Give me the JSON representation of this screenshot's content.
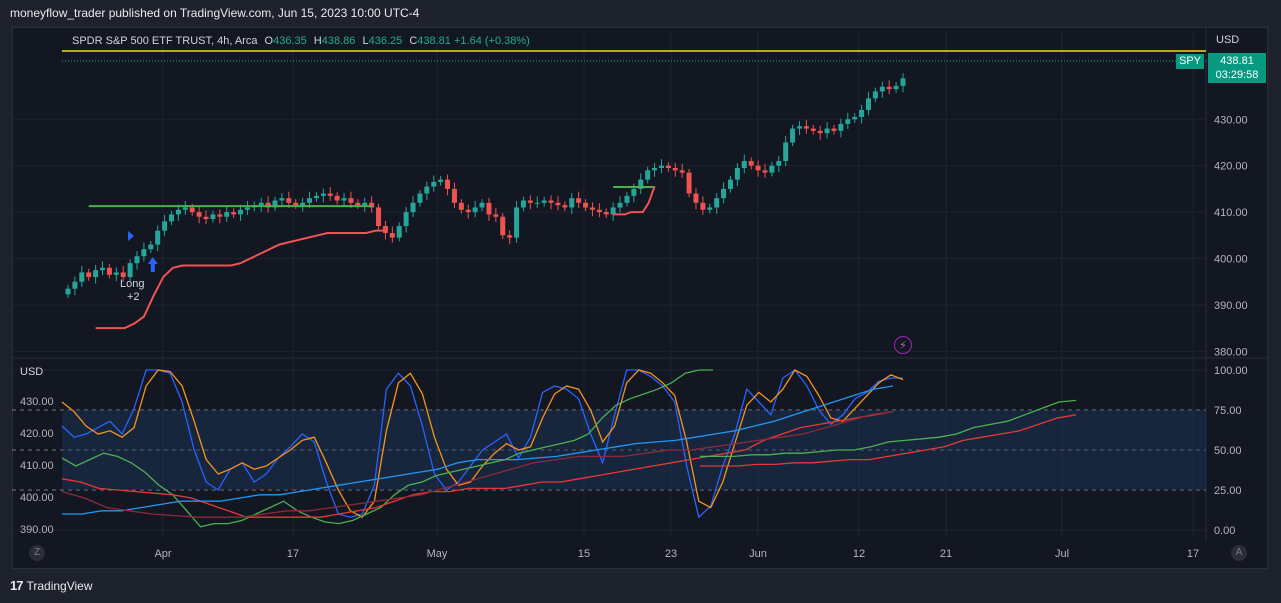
{
  "header": {
    "credit": "moneyflow_trader published on TradingView.com, Jun 15, 2023 10:00 UTC-4"
  },
  "symbol_line": {
    "title": "SPDR S&P 500 ETF TRUST, 4h, Arca",
    "o_label": "O",
    "o_value": "436.35",
    "h_label": "H",
    "h_value": "438.86",
    "l_label": "L",
    "l_value": "436.25",
    "c_label": "C",
    "c_value": "438.81",
    "change": "+1.64 (+0.38%)"
  },
  "price_panel": {
    "currency": "USD",
    "symbol_tag": "SPY",
    "last_price": "438.81",
    "countdown": "03:29:58",
    "signal_text": "Long",
    "signal_value": "+2"
  },
  "osc_panel": {
    "currency": "USD"
  },
  "footer": {
    "brand": "TradingView",
    "zoom_left": "Z",
    "zoom_right": "A"
  },
  "colors": {
    "up": "#26a69a",
    "down": "#ef5350",
    "resistance": "#4caf50",
    "trail_stop": "#f05454",
    "last_price_line": "#f0d723",
    "blue_osc": "#2962ff",
    "orange_osc": "#f7931a",
    "green_osc": "#4caf50",
    "red_osc": "#e53935",
    "cyan_osc": "#2196f3"
  },
  "chart_data": [
    {
      "type": "candlestick",
      "timeframe": "4h",
      "x_tick_labels": [
        "Apr",
        "17",
        "May",
        "15",
        "23",
        "Jun",
        "12",
        "21",
        "Jul",
        "17"
      ],
      "y_tick_labels": [
        "380.00",
        "390.00",
        "400.00",
        "410.00",
        "420.00",
        "430.00"
      ],
      "ylim": [
        379,
        446
      ],
      "closes": [
        393.5,
        395,
        397,
        396,
        397.5,
        398,
        396.5,
        397,
        396,
        399,
        400.5,
        402,
        403,
        406,
        408,
        409.5,
        410.5,
        411,
        410,
        409,
        408.5,
        409.5,
        409,
        410,
        409.5,
        410.5,
        411,
        411.5,
        412,
        411,
        412.5,
        413,
        412,
        411.5,
        412,
        413,
        413.5,
        414,
        413.5,
        412.5,
        413,
        412,
        411.5,
        412,
        411,
        407,
        405.5,
        404.5,
        407,
        410,
        412,
        414,
        415.5,
        416.5,
        417,
        415,
        412,
        410.5,
        410,
        411,
        412,
        409.5,
        409,
        405,
        404.5,
        411,
        412.5,
        412,
        412,
        412.5,
        412,
        411.5,
        411,
        413,
        412,
        411,
        410.5,
        410,
        409.5,
        411,
        412,
        413.5,
        415,
        417,
        419,
        419.5,
        420,
        419.5,
        419,
        418.5,
        414,
        412,
        410.5,
        411,
        413,
        415,
        417,
        419.5,
        421,
        420,
        419,
        418.5,
        420,
        421,
        425,
        428,
        428.5,
        428,
        427.5,
        427,
        428,
        427.5,
        429,
        430,
        430.5,
        432,
        434.5,
        436,
        437,
        436.5,
        437.2,
        438.81
      ],
      "resistance_segments": [
        {
          "from_index": 3,
          "to_index": 44,
          "value": 411.3
        },
        {
          "from_index": 79,
          "to_index": 85,
          "value": 415.4
        }
      ],
      "trail_stop": [
        385,
        385,
        385,
        385,
        386,
        387.5,
        392,
        396,
        398,
        398.5,
        398.5,
        398.5,
        398.5,
        398.5,
        398.5,
        399,
        400,
        401,
        402,
        403,
        403.5,
        404,
        404.5,
        405,
        405.5,
        405.5,
        405.5,
        405.5,
        405.5,
        406,
        406
      ],
      "trail_stop_2": [
        409.5,
        409.5,
        409.5,
        410,
        410,
        410,
        412,
        415.5
      ],
      "last_price": 438.81,
      "signal": {
        "label": "Long",
        "value": "+2",
        "index": 12
      }
    },
    {
      "type": "line",
      "panel": "oscillator",
      "y_tick_labels_right": [
        "0.00",
        "25.00",
        "50.00",
        "75.00",
        "100.00"
      ],
      "y_tick_labels_left": [
        "390.00",
        "400.00",
        "410.00",
        "420.00",
        "430.00"
      ],
      "ylim": [
        -5,
        105
      ],
      "levels": [
        0,
        25,
        50,
        75,
        100
      ],
      "series": [
        {
          "key": "blue_osc",
          "values": [
            65,
            58,
            60,
            64,
            68,
            60,
            76,
            100,
            100,
            98,
            80,
            50,
            30,
            25,
            38,
            42,
            30,
            35,
            45,
            52,
            60,
            55,
            30,
            10,
            8,
            10,
            28,
            88,
            98,
            90,
            65,
            35,
            25,
            30,
            40,
            50,
            55,
            60,
            45,
            58,
            86,
            90,
            88,
            82,
            60,
            42,
            72,
            100,
            100,
            96,
            90,
            80,
            40,
            8,
            15,
            40,
            60,
            88,
            80,
            72,
            95,
            100,
            90,
            75,
            66,
            72,
            82,
            86,
            93,
            95,
            95
          ]
        },
        {
          "key": "orange_osc",
          "values": [
            80,
            74,
            65,
            60,
            62,
            58,
            64,
            90,
            100,
            99,
            90,
            68,
            44,
            35,
            38,
            42,
            38,
            40,
            45,
            50,
            56,
            58,
            42,
            25,
            12,
            8,
            18,
            62,
            92,
            98,
            85,
            58,
            38,
            28,
            30,
            40,
            48,
            54,
            50,
            52,
            70,
            85,
            90,
            88,
            75,
            55,
            65,
            92,
            100,
            98,
            92,
            84,
            55,
            18,
            14,
            30,
            54,
            78,
            86,
            80,
            88,
            100,
            96,
            84,
            70,
            68,
            76,
            84,
            92,
            97,
            94
          ]
        },
        {
          "key": "green_osc",
          "values": [
            45,
            40,
            44,
            48,
            46,
            42,
            36,
            28,
            22,
            12,
            2,
            4,
            4,
            6,
            10,
            14,
            18,
            12,
            8,
            5,
            4,
            6,
            10,
            14,
            22,
            28,
            30,
            34,
            36,
            38,
            40,
            42,
            44,
            48,
            50,
            52,
            54,
            56,
            60,
            70,
            78,
            82,
            85,
            88,
            92,
            98,
            100,
            100
          ]
        },
        {
          "key": "red_osc",
          "values": [
            32,
            30,
            26,
            25,
            24,
            23,
            22,
            20,
            16,
            12,
            8,
            8,
            8,
            8,
            8,
            10,
            12,
            14,
            18,
            22,
            24,
            24,
            26,
            26,
            26,
            28,
            30,
            30,
            32,
            34,
            36,
            38,
            40,
            42,
            44,
            46,
            48,
            50,
            56,
            60,
            64,
            66,
            68,
            70,
            72,
            74
          ]
        },
        {
          "key": "cyan_osc",
          "values": [
            10,
            10,
            12,
            12,
            14,
            16,
            18,
            18,
            18,
            20,
            22,
            22,
            24,
            26,
            28,
            30,
            32,
            34,
            36,
            38,
            42,
            44,
            44,
            44,
            45,
            46,
            48,
            50,
            52,
            54,
            55,
            56,
            58,
            60,
            62,
            65,
            68,
            72,
            76,
            80,
            84,
            88,
            90
          ]
        },
        {
          "key": "dark_red_osc",
          "values": [
            24,
            20,
            14,
            12,
            10,
            9,
            8,
            8,
            8,
            10,
            12,
            12,
            14,
            16,
            18,
            20,
            22,
            26,
            30,
            34,
            38,
            42,
            44,
            46,
            46,
            46,
            48,
            50,
            50,
            52,
            54,
            56,
            58,
            60,
            64,
            68,
            72,
            74
          ]
        },
        {
          "key": "green_area",
          "values": [
            46,
            46,
            46,
            47,
            47,
            48,
            48,
            49,
            50,
            50,
            52,
            55,
            56,
            57,
            58,
            60,
            64,
            66,
            68,
            72,
            76,
            80,
            81
          ]
        },
        {
          "key": "pink_area",
          "values": [
            40,
            40,
            40,
            41,
            41,
            42,
            42,
            43,
            44,
            44,
            46,
            48,
            50,
            52,
            56,
            58,
            60,
            62,
            66,
            70,
            72
          ]
        }
      ]
    }
  ]
}
